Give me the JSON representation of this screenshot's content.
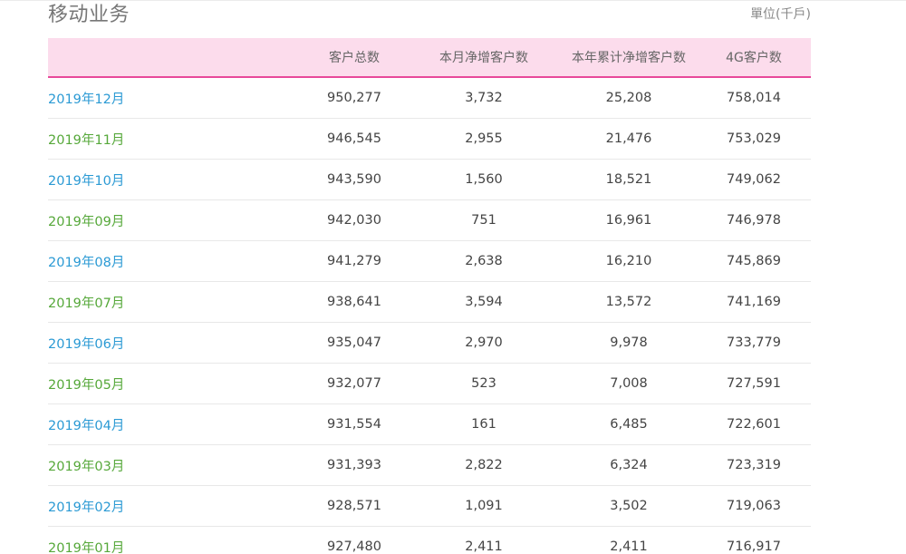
{
  "section": {
    "title": "移动业务",
    "unit": "單位(千戶)"
  },
  "table": {
    "headers": {
      "period": "",
      "total": "客户总数",
      "monthly_net_add": "本月净增客户数",
      "ytd_net_add": "本年累计净增客户数",
      "g4": "4G客户数"
    },
    "colors": {
      "header_bg": "#fcdcec",
      "header_rule": "#e8499a",
      "period_blue": "#2b9ad4",
      "period_green": "#56a83a"
    },
    "rows": [
      {
        "period": "2019年12月",
        "total": "950,277",
        "monthly_net_add": "3,732",
        "ytd_net_add": "25,208",
        "g4": "758,014"
      },
      {
        "period": "2019年11月",
        "total": "946,545",
        "monthly_net_add": "2,955",
        "ytd_net_add": "21,476",
        "g4": "753,029"
      },
      {
        "period": "2019年10月",
        "total": "943,590",
        "monthly_net_add": "1,560",
        "ytd_net_add": "18,521",
        "g4": "749,062"
      },
      {
        "period": "2019年09月",
        "total": "942,030",
        "monthly_net_add": "751",
        "ytd_net_add": "16,961",
        "g4": "746,978"
      },
      {
        "period": "2019年08月",
        "total": "941,279",
        "monthly_net_add": "2,638",
        "ytd_net_add": "16,210",
        "g4": "745,869"
      },
      {
        "period": "2019年07月",
        "total": "938,641",
        "monthly_net_add": "3,594",
        "ytd_net_add": "13,572",
        "g4": "741,169"
      },
      {
        "period": "2019年06月",
        "total": "935,047",
        "monthly_net_add": "2,970",
        "ytd_net_add": "9,978",
        "g4": "733,779"
      },
      {
        "period": "2019年05月",
        "total": "932,077",
        "monthly_net_add": "523",
        "ytd_net_add": "7,008",
        "g4": "727,591"
      },
      {
        "period": "2019年04月",
        "total": "931,554",
        "monthly_net_add": "161",
        "ytd_net_add": "6,485",
        "g4": "722,601"
      },
      {
        "period": "2019年03月",
        "total": "931,393",
        "monthly_net_add": "2,822",
        "ytd_net_add": "6,324",
        "g4": "723,319"
      },
      {
        "period": "2019年02月",
        "total": "928,571",
        "monthly_net_add": "1,091",
        "ytd_net_add": "3,502",
        "g4": "719,063"
      },
      {
        "period": "2019年01月",
        "total": "927,480",
        "monthly_net_add": "2,411",
        "ytd_net_add": "2,411",
        "g4": "716,917"
      }
    ]
  }
}
